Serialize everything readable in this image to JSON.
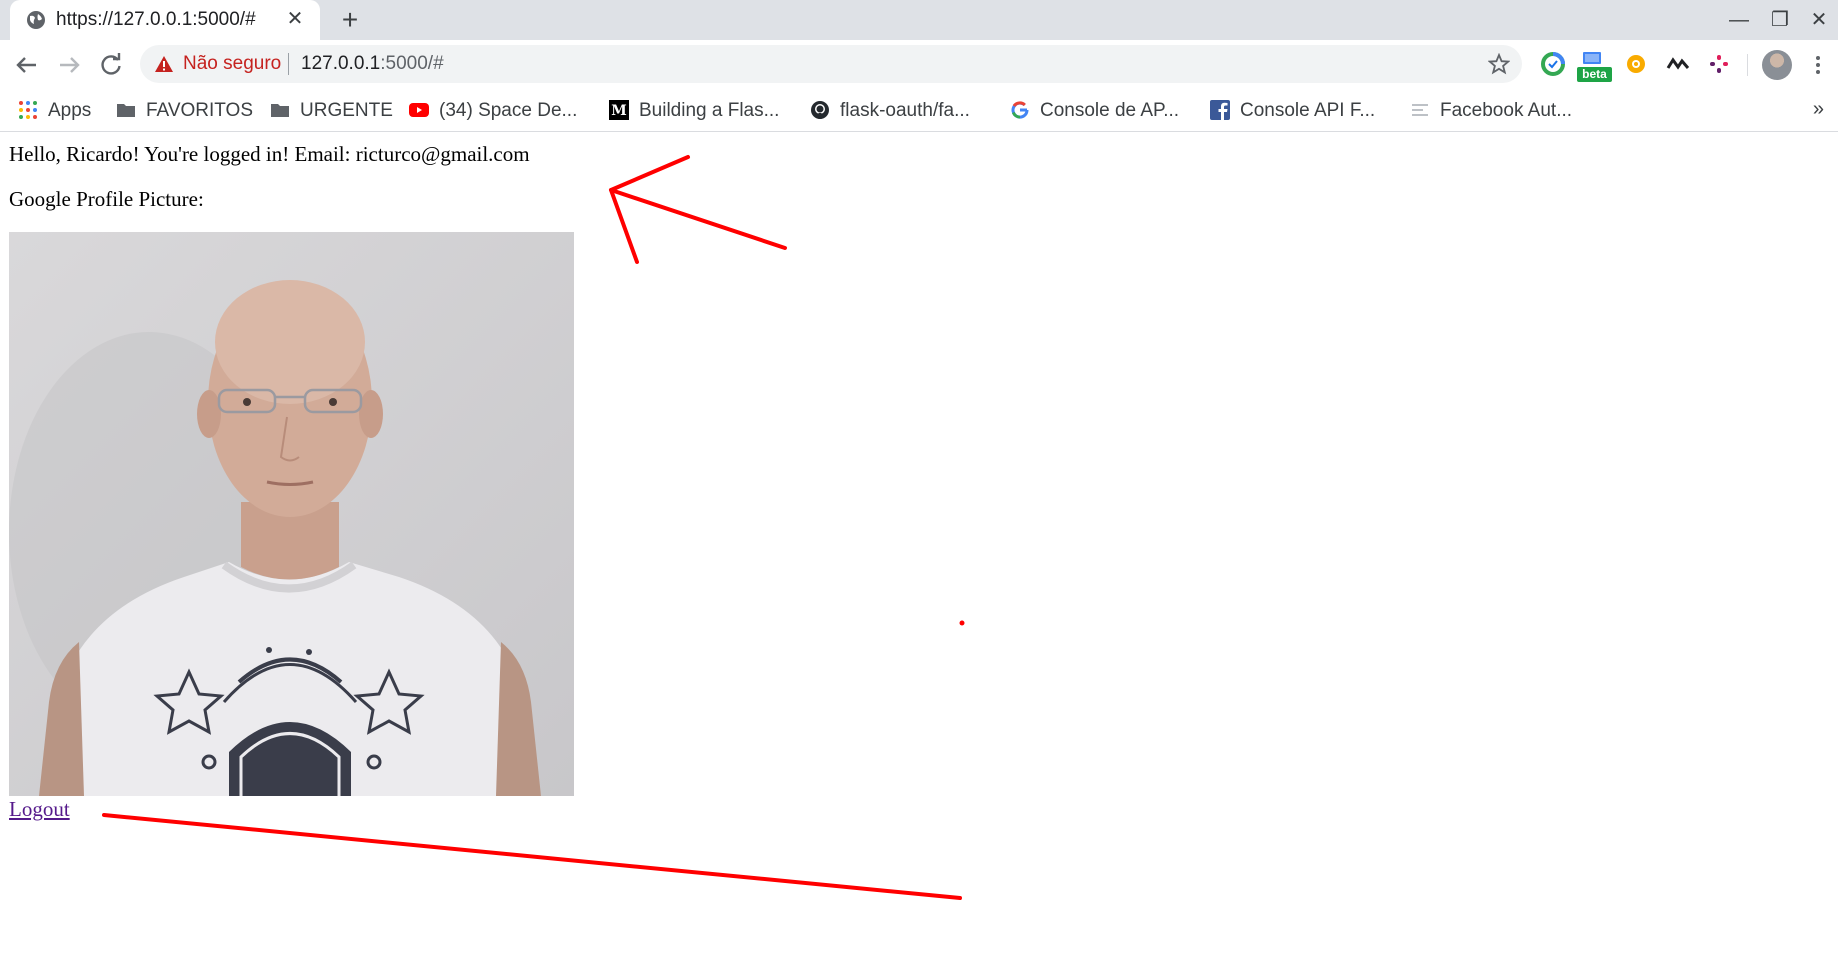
{
  "browser": {
    "tab": {
      "title": "https://127.0.0.1:5000/#",
      "close_glyph": "✕"
    },
    "new_tab_glyph": "+",
    "window_controls": {
      "minimize": "—",
      "restore": "❐",
      "close": "✕"
    },
    "omnibox": {
      "security_label": "Não seguro",
      "url_host": "127.0.0.1",
      "url_rest": ":5000/#"
    },
    "extensions": {
      "beta_badge": "beta"
    },
    "bookmarks": [
      {
        "label": "Apps",
        "icon": "apps-grid-icon"
      },
      {
        "label": "FAVORITOS",
        "icon": "folder-icon"
      },
      {
        "label": "URGENTE",
        "icon": "folder-icon"
      },
      {
        "label": "(34) Space De...",
        "icon": "youtube-icon"
      },
      {
        "label": "Building a Flas...",
        "icon": "medium-icon"
      },
      {
        "label": "flask-oauth/fa...",
        "icon": "github-icon"
      },
      {
        "label": "Console de AP...",
        "icon": "google-icon"
      },
      {
        "label": "Console API F...",
        "icon": "facebook-icon"
      },
      {
        "label": "Facebook Aut...",
        "icon": "generic-page-icon"
      }
    ],
    "bookmarks_more": "»"
  },
  "page": {
    "greeting": "Hello, Ricardo! You're logged in! Email: ricturco@gmail.com",
    "picture_label": "Google Profile Picture:",
    "logout_label": "Logout"
  },
  "colors": {
    "annotation": "#ff0000",
    "link_visited": "#551a8b",
    "security_warning": "#c5221f"
  }
}
